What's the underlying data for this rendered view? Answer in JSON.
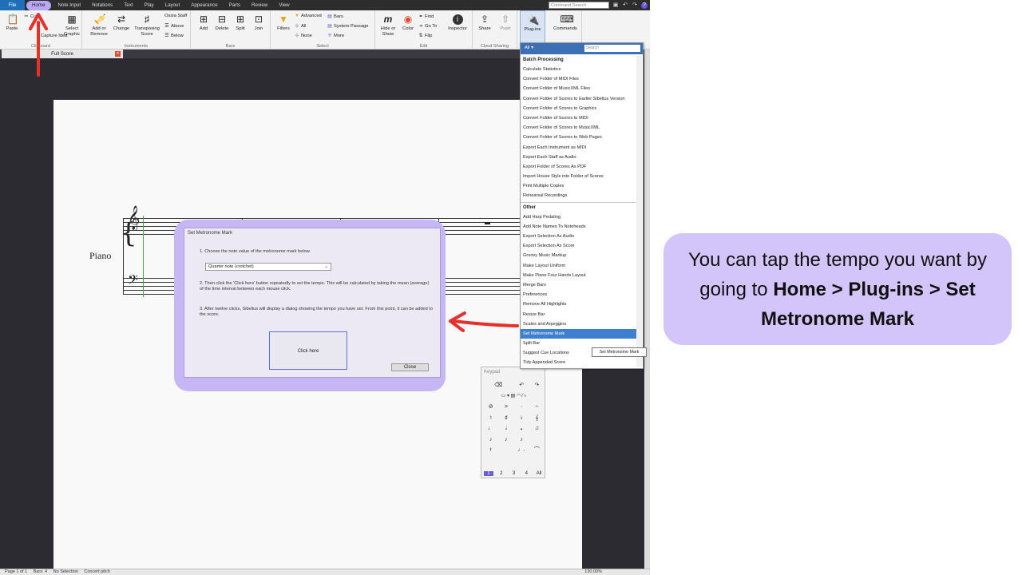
{
  "ribbon_tabs": [
    "File",
    "Home",
    "Note Input",
    "Notations",
    "Text",
    "Play",
    "Layout",
    "Appearance",
    "Parts",
    "Review",
    "View"
  ],
  "command_search_placeholder": "Command Search",
  "ribbon": {
    "clipboard": {
      "paste": "Paste",
      "cut": "Cut",
      "capture": "Capture Idea",
      "select_graphic": "Select Graphic",
      "label": "Clipboard"
    },
    "instruments": {
      "add_remove": "Add or Remove",
      "change": "Change",
      "transposing": "Transposing Score",
      "ossia": "Ossia Staff",
      "above": "Above",
      "below": "Below",
      "label": "Instruments"
    },
    "bars": {
      "add": "Add",
      "delete": "Delete",
      "split": "Split",
      "join": "Join",
      "label": "Bars"
    },
    "select": {
      "filters": "Filters",
      "advanced": "Advanced",
      "all": "All",
      "none": "None",
      "bars": "Bars",
      "system_passage": "System Passage",
      "more": "More",
      "label": "Select"
    },
    "edit": {
      "hide_show": "Hide or Show",
      "color": "Color",
      "find": "Find",
      "goto": "Go To",
      "flip": "Flip",
      "inspector": "Inspector",
      "label": "Edit"
    },
    "cloud": {
      "share": "Share",
      "push": "Push",
      "label": "Cloud Sharing"
    },
    "plugins": {
      "label": "Plug-ins"
    },
    "commands": {
      "label": "Commands"
    }
  },
  "doc_tab": "Full Score",
  "score": {
    "instrument": "Piano"
  },
  "dialog": {
    "title": "Set Metronome Mark",
    "step1": "1. Choose the note value of the metronome mark below.",
    "note_value": "Quarter note (crotchet)",
    "step2": "2. Then click the 'Click here' button repeatedly to set the tempo. This will be calculated by taking the mean (average) of the time interval between each mouse click.",
    "step3": "3. After twelve clicks, Sibelius will display a dialog showing the tempo you have set. From this point, it can be added to the score.",
    "click_here": "Click here",
    "close": "Close"
  },
  "plugins_menu": {
    "filter": "All",
    "search_placeholder": "Search",
    "categories": [
      {
        "name": "Batch Processing",
        "items": [
          "Calculate Statistics",
          "Convert Folder of MIDI Files",
          "Convert Folder of MusicXML Files",
          "Convert Folder of Scores to Earlier Sibelius Version",
          "Convert Folder of Scores to Graphics",
          "Convert Folder of Scores to MIDI",
          "Convert Folder of Scores to MusicXML",
          "Convert Folder of Scores to Web Pages",
          "Export Each Instrument as MIDI",
          "Export Each Staff as Audio",
          "Export Folder of Scores As PDF",
          "Import House Style into Folder of Scores",
          "Print Multiple Copies",
          "Rehearsal Recordings"
        ]
      },
      {
        "name": "Other",
        "items": [
          "Add Harp Pedaling",
          "Add Note Names To Noteheads",
          "Export Selection As Audio",
          "Export Selection As Score",
          "Groovy Music Markup",
          "Make Layout Uniform",
          "Make Piano Four Hands Layout",
          "Merge Bars",
          "Preferences",
          "Remove All Highlights",
          "Resize Bar",
          "Scales and Arpeggios",
          "Set Metronome Mark",
          "Split Bar",
          "Suggest Cue Locations",
          "Tidy Appended Score"
        ]
      }
    ],
    "selected": "Set Metronome Mark",
    "tooltip": "Set Metronome Mark"
  },
  "keypad": {
    "title": "Keypad",
    "tabs": [
      "1",
      "2",
      "3",
      "4",
      "All"
    ]
  },
  "status": {
    "page": "Page 1 of 1",
    "bars": "Bars: 4",
    "selection": "No Selection",
    "pitch": "Concert pitch",
    "zoom": "130.00%"
  },
  "callout": {
    "prefix": "You can tap the tempo you want by going to ",
    "path": "Home > Plug-ins > Set Metronome Mark"
  },
  "colors": {
    "highlight": "#c6b6f4",
    "callout_bg": "#d3c5fa",
    "arrow": "#e8302a",
    "selection": "#3f7fd0"
  }
}
